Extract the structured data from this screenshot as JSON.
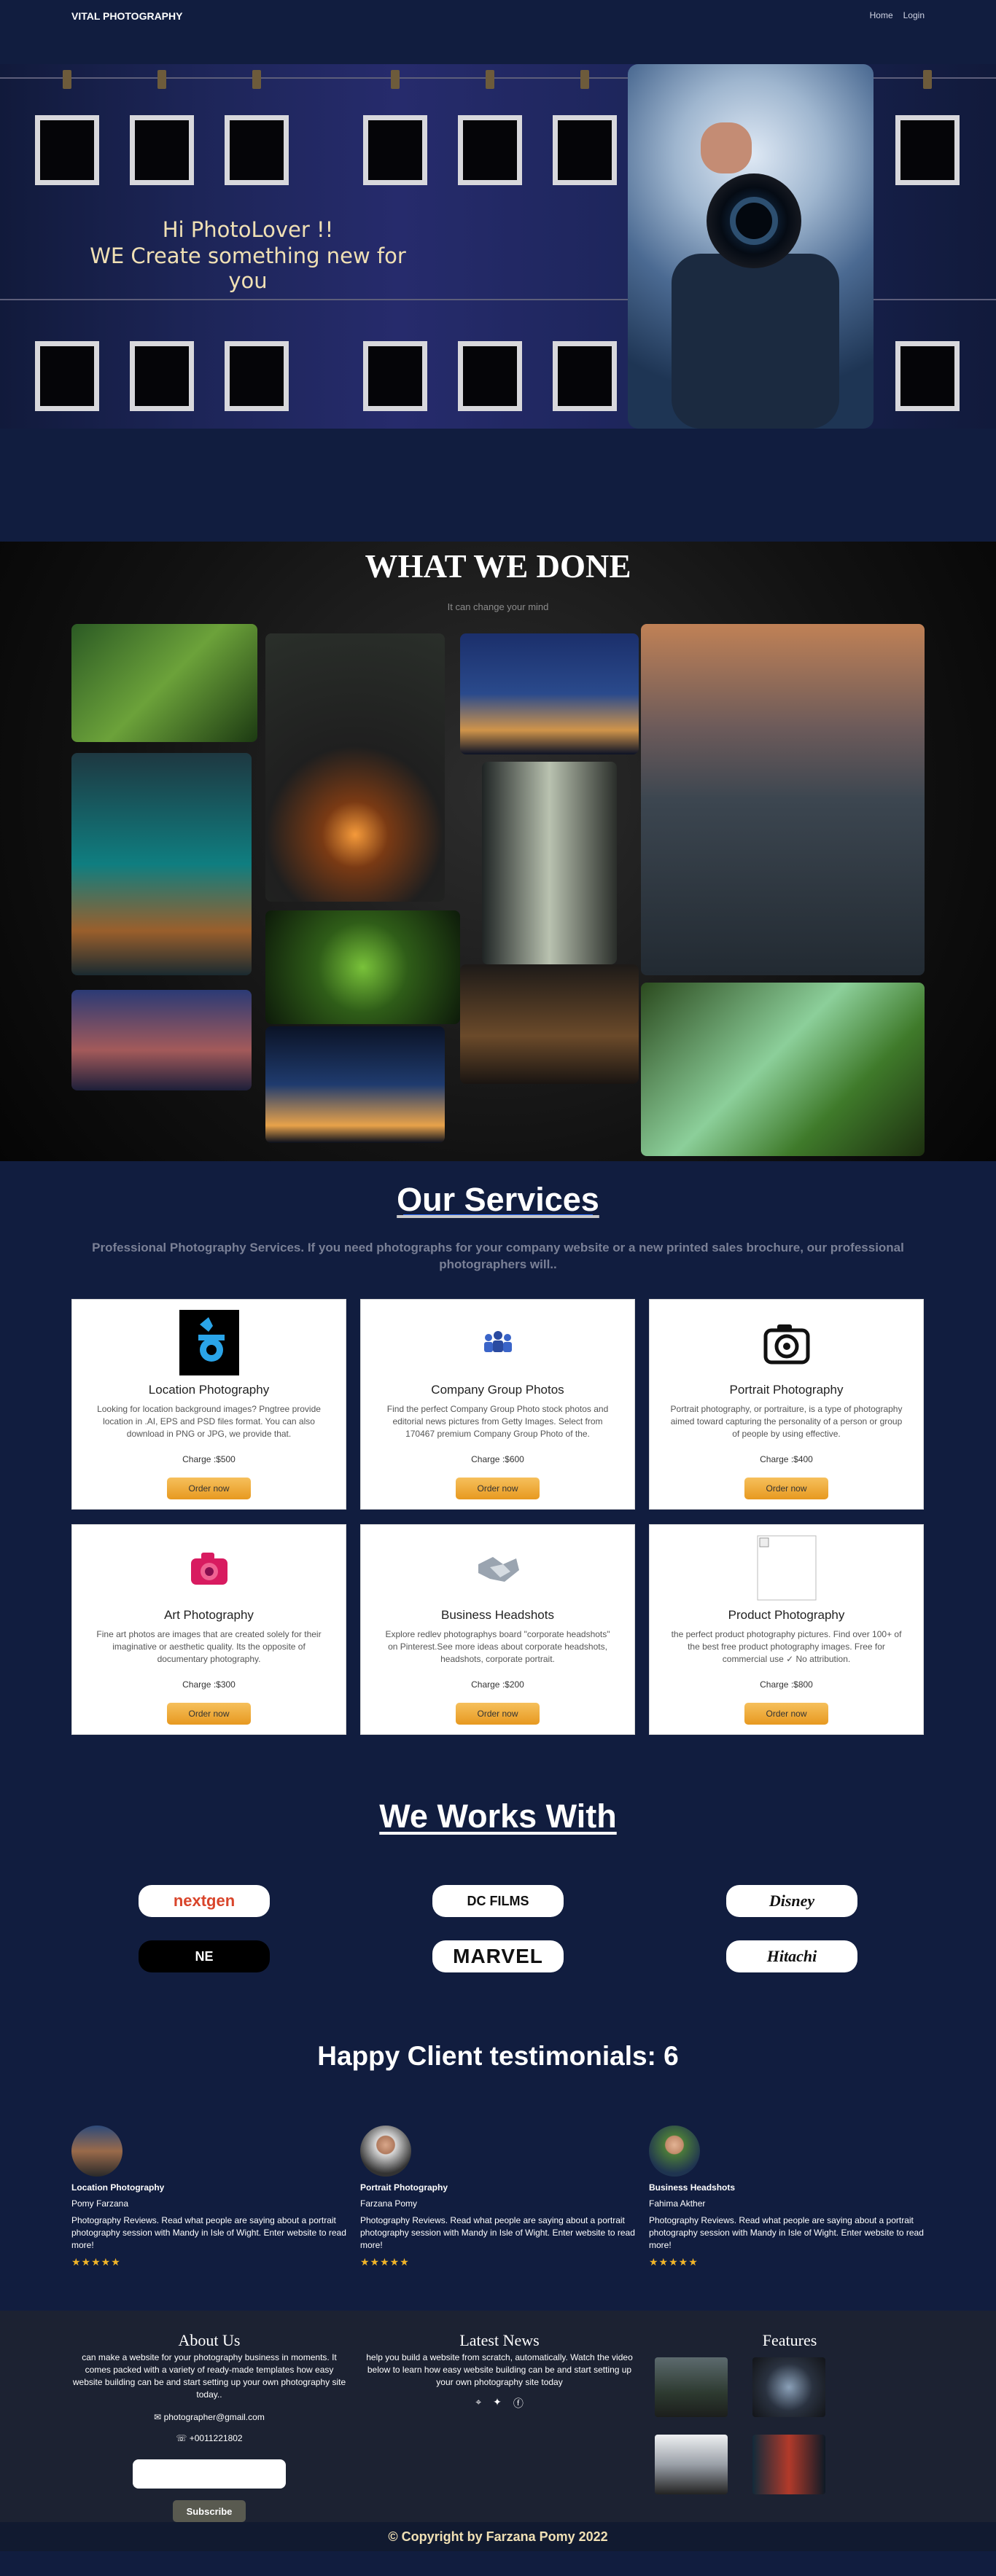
{
  "nav": {
    "brand": "VITAL PHOTOGRAPHY",
    "home": "Home",
    "login": "Login"
  },
  "hero": {
    "line1": "Hi PhotoLover !!",
    "line2": "WE Create something new for you"
  },
  "gallery": {
    "title": "WHAT WE DONE",
    "subtitle": "It can change your mind"
  },
  "services": {
    "title": "Our Services",
    "subtitle": "Professional Photography Services. If you need photographs for your company website or a new printed sales brochure, our professional photographers will..",
    "items": [
      {
        "title": "Location Photography",
        "desc": "Looking for location background images? Pngtree provide location in .AI, EPS and PSD files format. You can also download in PNG or JPG, we provide that.",
        "charge": "Charge :$500",
        "button": "Order now",
        "icon": "location-photo-icon"
      },
      {
        "title": "Company Group Photos",
        "desc": "Find the perfect Company Group Photo stock photos and editorial news pictures from Getty Images. Select from 170467 premium Company Group Photo of the.",
        "charge": "Charge :$600",
        "button": "Order now",
        "icon": "group-icon"
      },
      {
        "title": "Portrait Photography",
        "desc": "Portrait photography, or portraiture, is a type of photography aimed toward capturing the personality of a person or group of people by using effective.",
        "charge": "Charge :$400",
        "button": "Order now",
        "icon": "camera-icon"
      },
      {
        "title": "Art Photography",
        "desc": "Fine art photos are images that are created solely for their imaginative or aesthetic quality. Its the opposite of documentary photography.",
        "charge": "Charge :$300",
        "button": "Order now",
        "icon": "pink-camera-icon"
      },
      {
        "title": "Business Headshots",
        "desc": "Explore redlev photographys board \"corporate headshots\" on Pinterest.See more ideas about corporate headshots, headshots, corporate portrait.",
        "charge": "Charge :$200",
        "button": "Order now",
        "icon": "handshake-icon"
      },
      {
        "title": "Product Photography",
        "desc": "the perfect product photography pictures. Find over 100+ of the best free product photography images. Free for commercial use ✓ No attribution.",
        "charge": "Charge :$800",
        "button": "Order now",
        "icon": "broken-image-icon"
      }
    ]
  },
  "works": {
    "title": "We Works With",
    "logos": [
      "nextgen",
      "DC FILMS",
      "Disney",
      "NE",
      "MARVEL",
      "Hitachi"
    ]
  },
  "testimonials": {
    "title": "Happy Client testimonials: 6",
    "items": [
      {
        "category": "Location Photography",
        "name": "Pomy Farzana",
        "text": "Photography Reviews. Read what people are saying about a portrait photography session with Mandy in Isle of Wight. Enter website to read more!",
        "stars": "★★★★★"
      },
      {
        "category": "Portrait Photography",
        "name": "Farzana Pomy",
        "text": "Photography Reviews. Read what people are saying about a portrait photography session with Mandy in Isle of Wight. Enter website to read more!",
        "stars": "★★★★★"
      },
      {
        "category": "Business Headshots",
        "name": "Fahima Akther",
        "text": "Photography Reviews. Read what people are saying about a portrait photography session with Mandy in Isle of Wight. Enter website to read more!",
        "stars": "★★★★★"
      }
    ]
  },
  "footer": {
    "about_title": "About Us",
    "about_text": "can make a website for your photography business in moments. It comes packed with a variety of ready-made templates how easy website building can be and start setting up your own photography site today..",
    "email": "photographer@gmail.com",
    "phone": "+0011221802",
    "subscribe_placeholder": "",
    "subscribe_button": "Subscribe",
    "news_title": "Latest News",
    "news_text": "help you build a website from scratch, automatically. Watch the video below to learn how easy website building can be and start setting up your own photography site today",
    "features_title": "Features",
    "copyright": "© Copyright by Farzana Pomy 2022"
  },
  "colors": {
    "bg": "#111d3f",
    "accent": "#f0b429",
    "link_underline": "#2f6fff"
  }
}
